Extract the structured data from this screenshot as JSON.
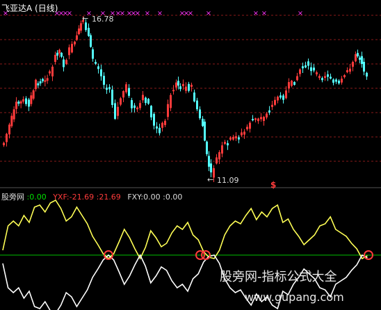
{
  "window": {
    "title": "飞亚达A (日线)"
  },
  "upper_panel": {
    "high_price_label": "16.78",
    "low_price_label": "11.09",
    "marker_glyph": "$",
    "x_marker_glyph": "×"
  },
  "lower_panel": {
    "indicator_name": "股旁网",
    "v1": ":0.00",
    "yxf_label": "YXF:",
    "yxf_v1": "-21.69",
    "yxf_v2": ":21.69",
    "fxy_label": "FXY:0.00",
    "fxy_v2": ":0.00"
  },
  "watermark": {
    "line1": "股旁网-指标公式大全",
    "line2": "www.gupang.com"
  },
  "colors": {
    "background": "#000000",
    "up_candle": "#ff3b3b",
    "down_candle": "#54ffff",
    "grid": "#8b1a1a",
    "yellow_line": "#ffff55",
    "white_line": "#ffffff",
    "zero_line": "#00c000",
    "marker": "#ff33ff"
  }
}
